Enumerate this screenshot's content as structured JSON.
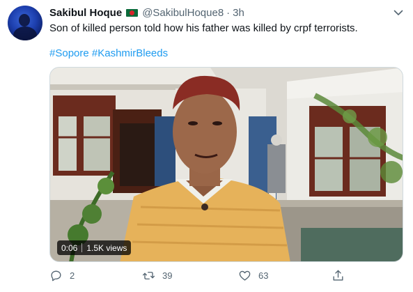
{
  "tweet": {
    "author_name": "Sakibul Hoque",
    "handle": "@SakibulHoque8",
    "separator": "·",
    "time": "3h",
    "text": "Son of killed person told how his father was killed by crpf terrorists.",
    "hashtags": [
      "#Sopore",
      "#KashmirBleeds"
    ]
  },
  "media": {
    "duration": "0:06",
    "views": "1.5K views"
  },
  "actions": {
    "reply_count": "2",
    "retweet_count": "39",
    "like_count": "63"
  },
  "icons": {
    "reply": "reply-icon",
    "retweet": "retweet-icon",
    "like": "like-icon",
    "share": "share-icon",
    "more": "chevron-down-icon"
  },
  "colors": {
    "link": "#1d9bf0",
    "muted": "#536471",
    "flag_green": "#0b6a3a",
    "flag_red": "#d8232a"
  }
}
